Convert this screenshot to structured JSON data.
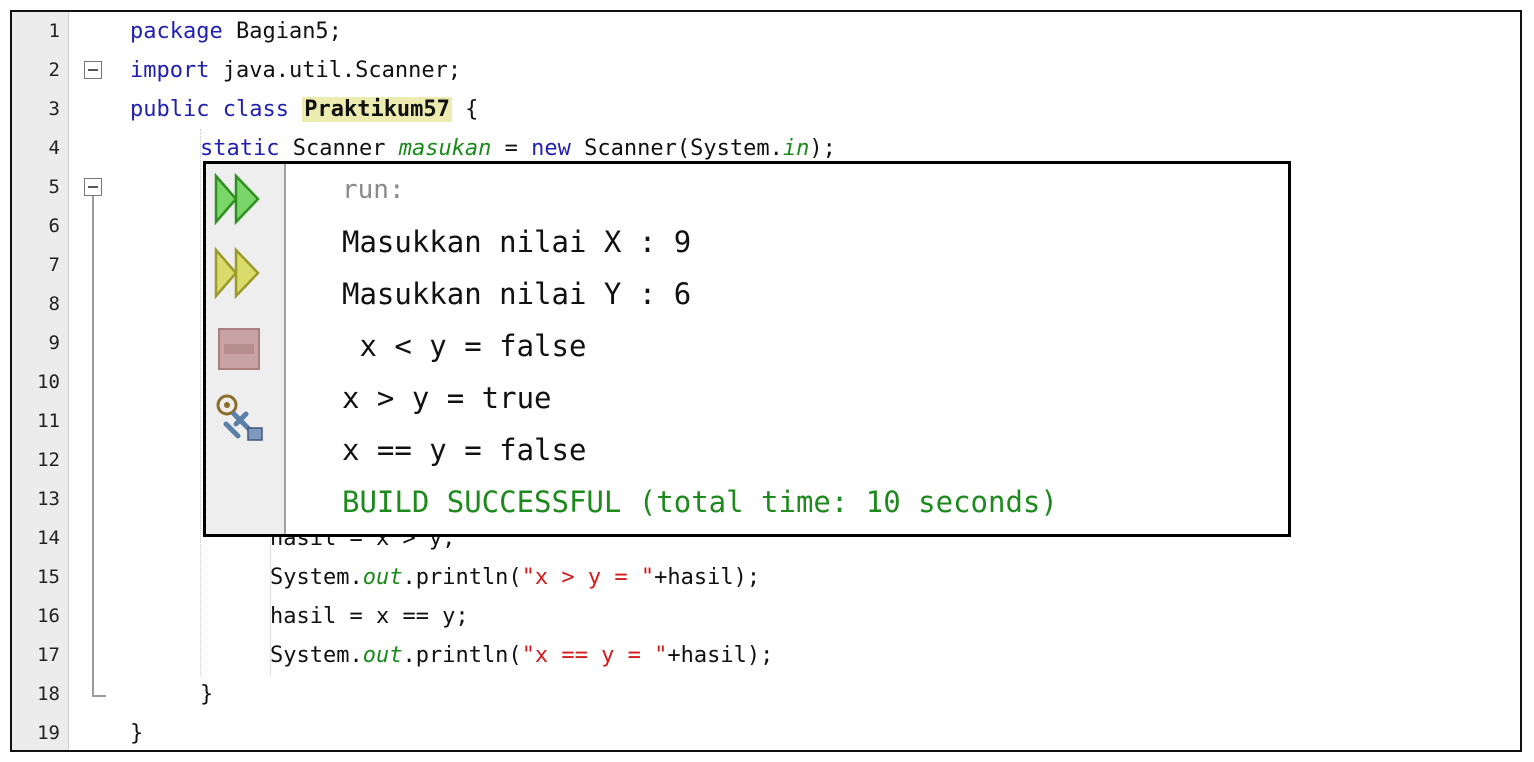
{
  "editor": {
    "line_numbers": [
      "1",
      "2",
      "3",
      "4",
      "5",
      "6",
      "7",
      "8",
      "9",
      "10",
      "11",
      "12",
      "13",
      "14",
      "15",
      "16",
      "17",
      "18",
      "19"
    ],
    "lines": {
      "l1": {
        "kw": "package",
        "rest": " Bagian5;"
      },
      "l2": {
        "kw": "import",
        "rest": " java.util.Scanner;"
      },
      "l3": {
        "kw1": "public",
        "kw2": "class",
        "cls": "Praktikum57",
        "rest": " {"
      },
      "l4": {
        "kw": "static",
        "t1": " Scanner ",
        "fld": "masukan",
        "t2": " = ",
        "kw2": "new",
        "t3": " Scanner(System.",
        "fld2": "in",
        "t4": ");"
      },
      "l14": {
        "text": "hasil = x > y;"
      },
      "l15": {
        "t1": "System.",
        "fld": "out",
        "t2": ".println(",
        "str": "\"x > y = \"",
        "t3": "+hasil);"
      },
      "l16": {
        "text": "hasil = x == y;"
      },
      "l17": {
        "t1": "System.",
        "fld": "out",
        "t2": ".println(",
        "str": "\"x == y = \"",
        "t3": "+hasil);"
      },
      "l18": {
        "text": "}"
      },
      "l19": {
        "text": "}"
      }
    }
  },
  "output": {
    "run_label": "run:",
    "lines": [
      "Masukkan nilai X : 9",
      "Masukkan nilai Y : 6",
      " x < y = false",
      "x > y = true",
      "x == y = false"
    ],
    "build_status": "BUILD SUCCESSFUL (total time: 10 seconds)",
    "toolbar_icons": [
      "run-again-icon",
      "rerun-with-options-icon",
      "stop-icon",
      "settings-icon"
    ]
  },
  "colors": {
    "keyword": "#1f1fb0",
    "string": "#d11a1a",
    "field": "#1a8a1a",
    "class_highlight": "#ecebb0",
    "build_success": "#1e8a1e"
  }
}
